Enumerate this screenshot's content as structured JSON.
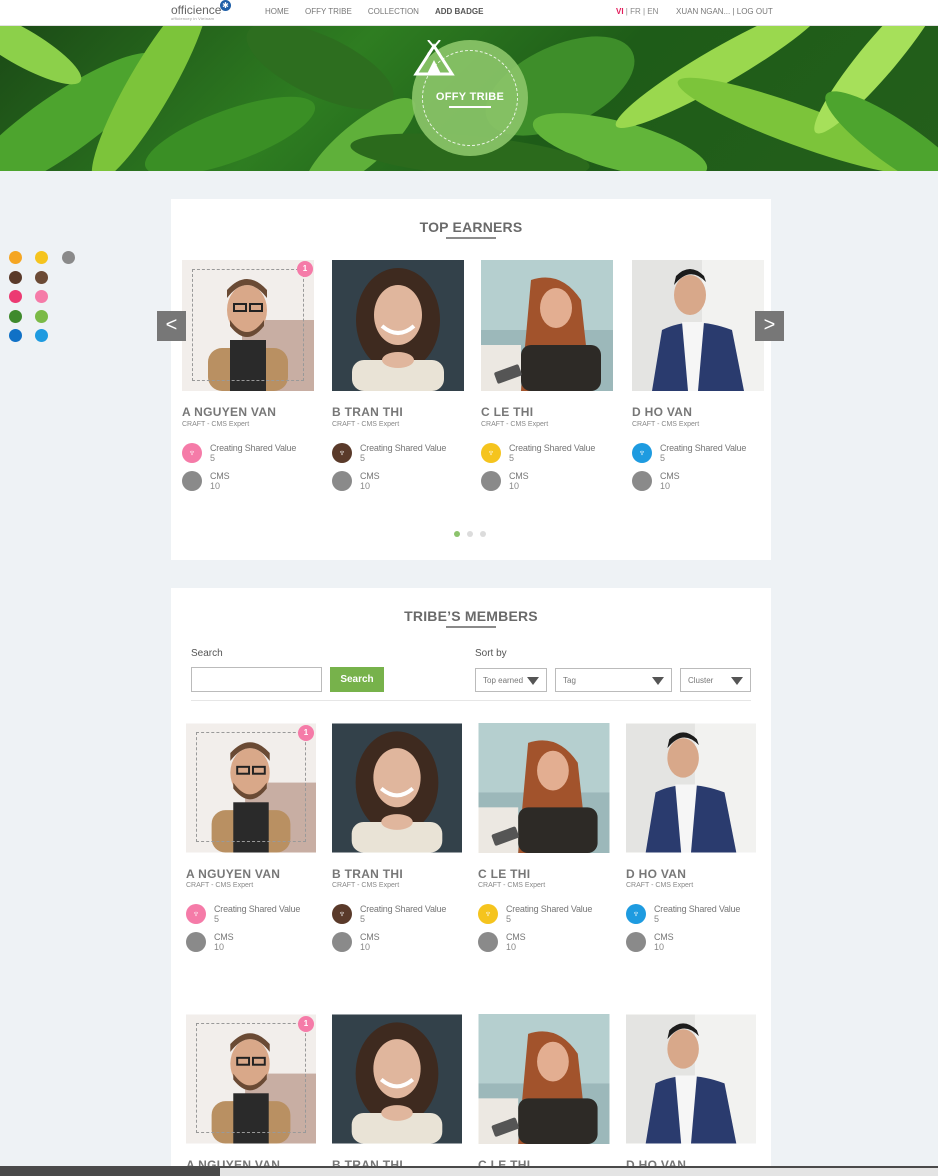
{
  "nav": {
    "logo": "officience",
    "logo_sub": "officiencey in Vietnam",
    "links": [
      "HOME",
      "OFFY TRIBE",
      "COLLECTION",
      "ADD BADGE"
    ],
    "lang_active": "VI",
    "lang_rest": " | FR | EN",
    "user": "XUAN NGAN... | LOG OUT"
  },
  "hero": {
    "badge_text": "OFFY TRIBE"
  },
  "swatches": [
    "#f5a623",
    "#f5c41e",
    "#8a8a8a",
    "#5a3a2a",
    "#6b4a35",
    "#ec3a72",
    "#f57ba8",
    "#3f8a2c",
    "#7bba46",
    "#1071c6",
    "#1e9be0"
  ],
  "top_earners": {
    "title": "TOP EARNERS",
    "rank": "1",
    "cards": [
      {
        "name": "A NGUYEN VAN",
        "role": "CRAFT - CMS Expert",
        "badge_label": "Creating Shared Value",
        "badge_value": "5",
        "badge_color": "#f57ba8",
        "cms_label": "CMS",
        "cms_value": "10"
      },
      {
        "name": "B TRAN THI",
        "role": "CRAFT - CMS Expert",
        "badge_label": "Creating Shared Value",
        "badge_value": "5",
        "badge_color": "#5a3a2a",
        "cms_label": "CMS",
        "cms_value": "10"
      },
      {
        "name": "C LE THI",
        "role": "CRAFT - CMS Expert",
        "badge_label": "Creating Shared Value",
        "badge_value": "5",
        "badge_color": "#f5c41e",
        "cms_label": "CMS",
        "cms_value": "10"
      },
      {
        "name": "D HO VAN",
        "role": "CRAFT - CMS Expert",
        "badge_label": "Creating Shared Value",
        "badge_value": "5",
        "badge_color": "#1e9be0",
        "cms_label": "CMS",
        "cms_value": "10"
      }
    ],
    "prev": "<",
    "next": ">"
  },
  "members": {
    "title": "TRIBE’S MEMBERS",
    "search_label": "Search",
    "search_value": "",
    "search_button": "Search",
    "sort_label": "Sort by",
    "sort_selects": [
      "Top earned",
      "Tag",
      "Cluster"
    ],
    "rank": "1",
    "cards": [
      {
        "name": "A NGUYEN VAN",
        "role": "CRAFT - CMS Expert",
        "badge_label": "Creating Shared Value",
        "badge_value": "5",
        "badge_color": "#f57ba8",
        "cms_label": "CMS",
        "cms_value": "10"
      },
      {
        "name": "B TRAN THI",
        "role": "CRAFT - CMS Expert",
        "badge_label": "Creating Shared Value",
        "badge_value": "5",
        "badge_color": "#5a3a2a",
        "cms_label": "CMS",
        "cms_value": "10"
      },
      {
        "name": "C LE THI",
        "role": "CRAFT - CMS Expert",
        "badge_label": "Creating Shared Value",
        "badge_value": "5",
        "badge_color": "#f5c41e",
        "cms_label": "CMS",
        "cms_value": "10"
      },
      {
        "name": "D HO VAN",
        "role": "CRAFT - CMS Expert",
        "badge_label": "Creating Shared Value",
        "badge_value": "5",
        "badge_color": "#1e9be0",
        "cms_label": "CMS",
        "cms_value": "10"
      }
    ],
    "second_row_names": [
      "A NGUYEN VAN",
      "B TRAN THI",
      "C LE THI",
      "D HO VAN"
    ]
  }
}
